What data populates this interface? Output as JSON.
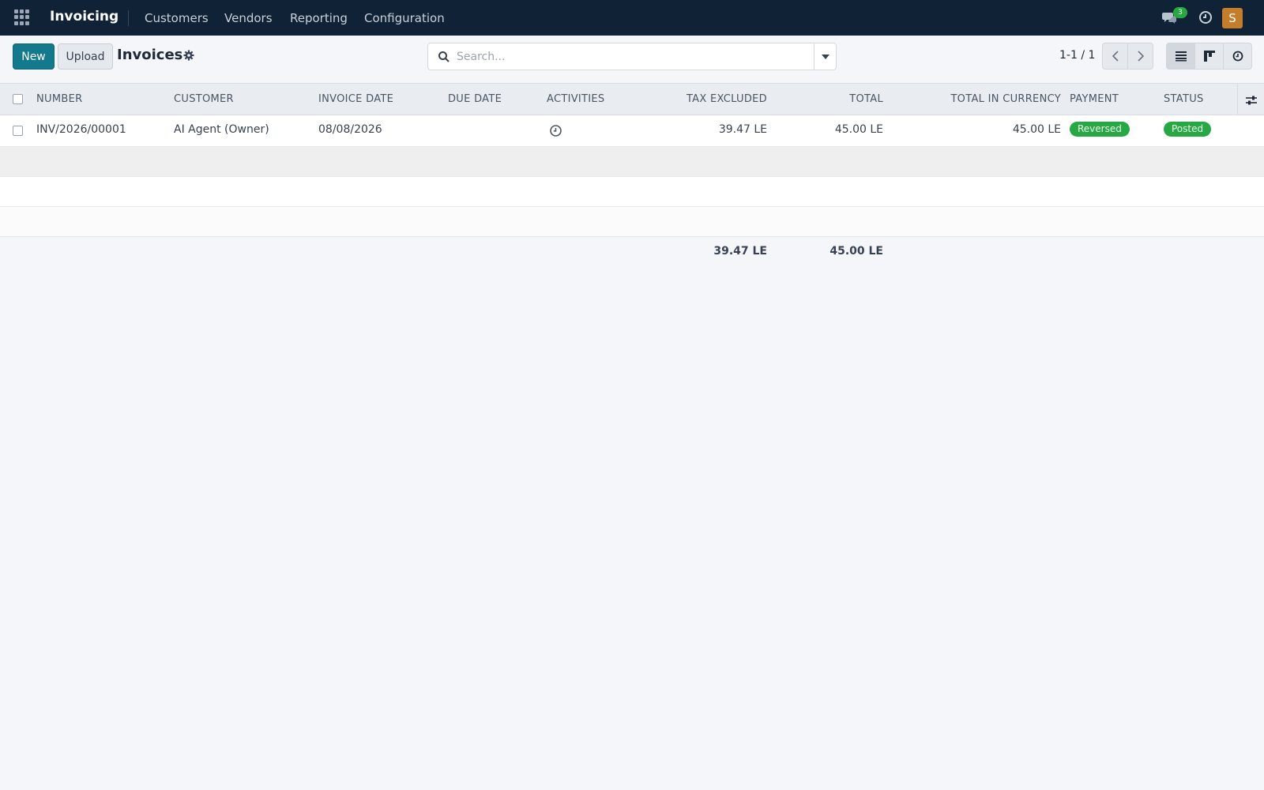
{
  "navbar": {
    "brand": "Invoicing",
    "menus": [
      "Customers",
      "Vendors",
      "Reporting",
      "Configuration"
    ],
    "chat_count": "3",
    "user_initial": "S"
  },
  "control_panel": {
    "new_label": "New",
    "upload_label": "Upload",
    "title": "Invoices",
    "search_placeholder": "Search...",
    "pager": "1-1 / 1"
  },
  "table": {
    "columns": [
      "NUMBER",
      "CUSTOMER",
      "INVOICE DATE",
      "DUE DATE",
      "ACTIVITIES",
      "TAX EXCLUDED",
      "TOTAL",
      "TOTAL IN CURRENCY",
      "PAYMENT",
      "STATUS"
    ],
    "rows": [
      {
        "number": "INV/2026/00001",
        "customer": "AI Agent (Owner)",
        "invoice_date": "08/08/2026",
        "due_date": "",
        "tax_excluded": "39.47 LE",
        "total": "45.00 LE",
        "total_in_currency": "45.00 LE",
        "payment": "Reversed",
        "status": "Posted"
      }
    ],
    "totals": {
      "tax_excluded": "39.47 LE",
      "total": "45.00 LE"
    }
  },
  "colors": {
    "navbar_bg": "#102235",
    "primary": "#127a8c",
    "success_badge": "#28a745",
    "avatar": "#c47d2a"
  },
  "icons": [
    "apps-grid-icon",
    "chat-icon",
    "clock-icon",
    "gear-icon",
    "search-icon",
    "caret-down-icon",
    "chevron-left-icon",
    "chevron-right-icon",
    "list-view-icon",
    "kanban-view-icon",
    "activity-view-icon",
    "column-settings-icon"
  ]
}
